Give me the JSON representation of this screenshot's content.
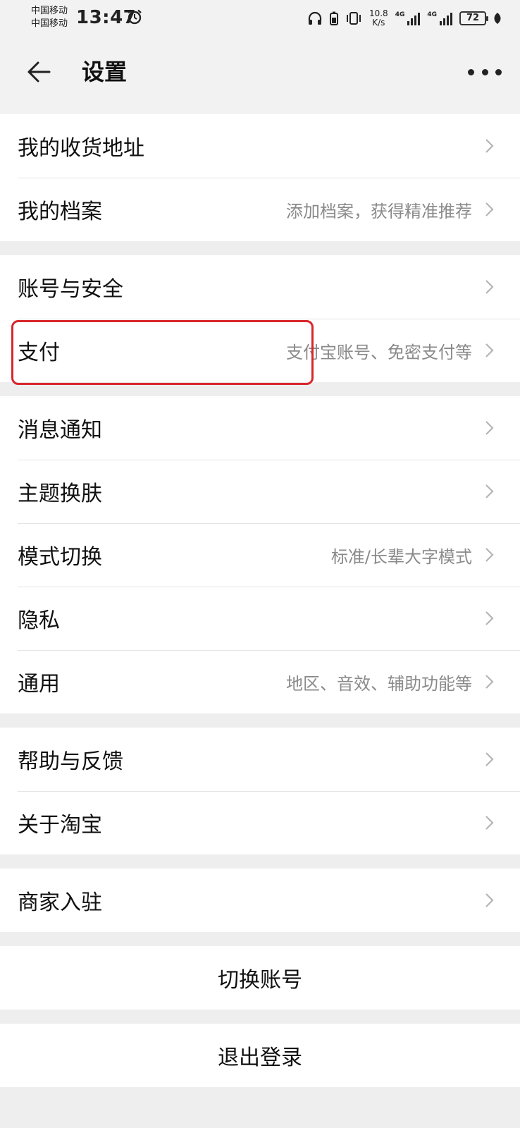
{
  "status_bar": {
    "carrier_1": "中国移动",
    "carrier_2": "中国移动",
    "time": "13:47",
    "net_speed_value": "10.8",
    "net_speed_unit": "K/s",
    "lte_1": "4G",
    "lte_2": "4G",
    "battery": "72"
  },
  "header": {
    "title": "设置"
  },
  "groups": [
    [
      {
        "label": "我的收货地址",
        "sub": ""
      },
      {
        "label": "我的档案",
        "sub": "添加档案，获得精准推荐"
      }
    ],
    [
      {
        "label": "账号与安全",
        "sub": ""
      },
      {
        "label": "支付",
        "sub": "支付宝账号、免密支付等"
      }
    ],
    [
      {
        "label": "消息通知",
        "sub": ""
      },
      {
        "label": "主题换肤",
        "sub": ""
      },
      {
        "label": "模式切换",
        "sub": "标准/长辈大字模式"
      },
      {
        "label": "隐私",
        "sub": ""
      },
      {
        "label": "通用",
        "sub": "地区、音效、辅助功能等"
      }
    ],
    [
      {
        "label": "帮助与反馈",
        "sub": ""
      },
      {
        "label": "关于淘宝",
        "sub": ""
      }
    ],
    [
      {
        "label": "商家入驻",
        "sub": ""
      }
    ]
  ],
  "switch_account": "切换账号",
  "logout": "退出登录",
  "colors": {
    "highlight": "#d9262c"
  }
}
